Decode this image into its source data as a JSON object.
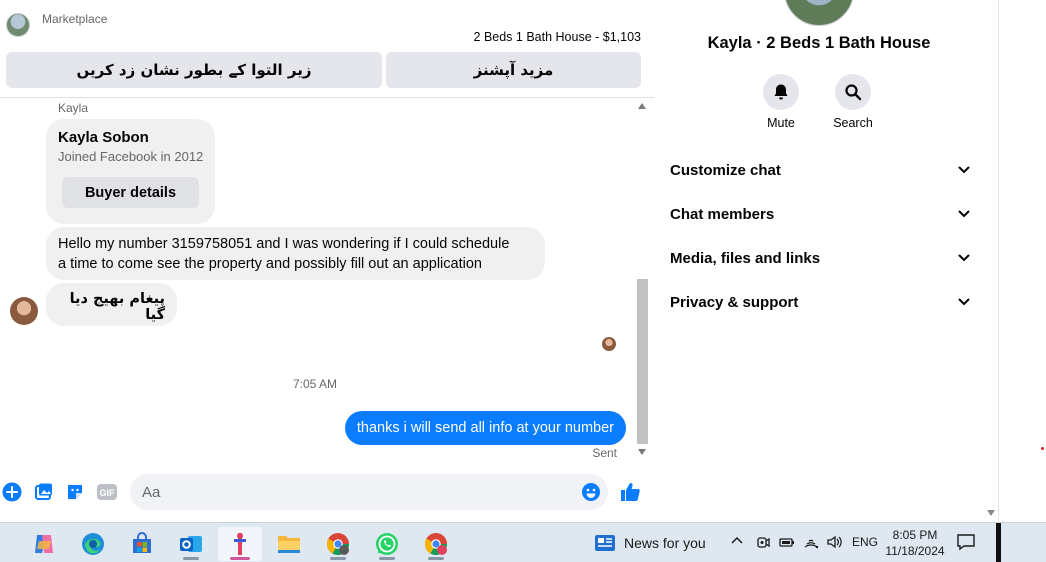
{
  "header": {
    "marketplace_label": "Marketplace",
    "listing_title": "2 Beds 1 Bath House - $1,103",
    "mark_pending_label": "زیر التوا کے بطور نشان زد کریں",
    "more_options_label": "مزید آپشنز"
  },
  "messages": {
    "sender_name": "Kayla",
    "profile_card": {
      "name": "Kayla Sobon",
      "joined": "Joined Facebook in 2012",
      "button_label": "Buyer details"
    },
    "incoming_1_line1": "Hello my number 3159758051 and I was wondering if I could schedule",
    "incoming_1_line2": "a time to come see the property and possibly fill out an application",
    "incoming_2": "پیغام بھیج دیا گیا",
    "timestamp": "7:05 AM",
    "outgoing_1": "thanks i will send all info at your number",
    "sent_status": "Sent"
  },
  "composer": {
    "placeholder": "Aa",
    "gif_label": "GIF"
  },
  "info_pane": {
    "title": "Kayla · 2 Beds 1 Bath House",
    "actions": [
      {
        "label": "Mute",
        "icon": "bell-icon"
      },
      {
        "label": "Search",
        "icon": "search-icon"
      }
    ],
    "sections": [
      {
        "label": "Customize chat"
      },
      {
        "label": "Chat members"
      },
      {
        "label": "Media, files and links"
      },
      {
        "label": "Privacy & support"
      }
    ]
  },
  "taskbar": {
    "apps": [
      "copilot-icon",
      "edge-icon",
      "store-icon",
      "outlook-icon",
      "active-app-icon",
      "file-explorer-icon",
      "chrome-icon",
      "whatsapp-icon",
      "chrome-profile-icon"
    ],
    "news_label": "News for you",
    "lang": "ENG",
    "time": "8:05 PM",
    "date": "11/18/2024"
  },
  "colors": {
    "messenger_blue": "#0a7cff",
    "bubble_gray": "#f0f0f0",
    "button_gray": "#e4e6eb"
  }
}
